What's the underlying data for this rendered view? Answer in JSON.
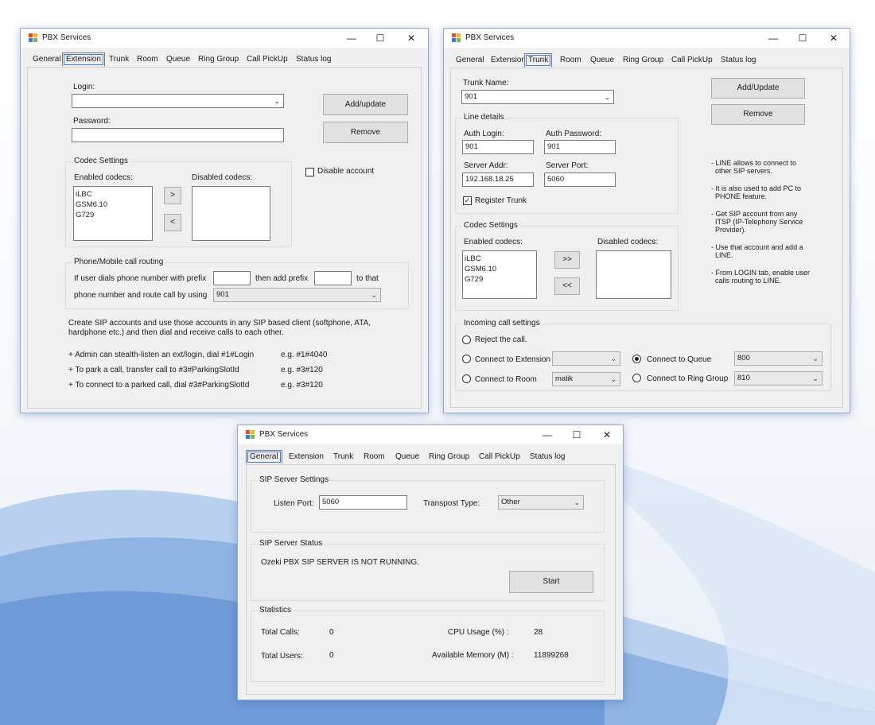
{
  "colors": {
    "window_border": "#8faad6",
    "button_face": "#e1e1e1",
    "form_bg": "#f0f0f0",
    "accent": "#3c7ed6"
  },
  "icons": {
    "app": "pbx-app-icon",
    "minimize": "minimize-icon",
    "maximize": "maximize-icon",
    "close": "close-icon",
    "dropdown": "chevron-down-icon"
  },
  "window_title": "PBX Services",
  "tabs": [
    "General",
    "Extension",
    "Trunk",
    "Room",
    "Queue",
    "Ring Group",
    "Call PickUp",
    "Status log"
  ],
  "ctl": {
    "min": "—",
    "max": "☐",
    "close": "✕",
    "arrow": "⌄",
    "check": "✓"
  },
  "extension": {
    "login_label": "Login:",
    "login_value": "",
    "password_label": "Password:",
    "password_value": "",
    "add_update": "Add/update",
    "remove": "Remove",
    "codec_group": "Codec Settings",
    "enabled_label": "Enabled codecs:",
    "disabled_label": "Disabled codecs:",
    "enabled": [
      "iLBC",
      "GSM6.10",
      "G729"
    ],
    "move_right": ">",
    "move_left": "<",
    "disable_account": "Disable account",
    "routing_group": "Phone/Mobile call routing",
    "prefix_text": "If user dials phone number with prefix",
    "prefix_value": "",
    "add_prefix_text": "then add prefix",
    "add_prefix_value": "",
    "to_that": "to that",
    "route_text": "phone number and route call by using",
    "route_value": "901",
    "info1": "Create SIP accounts and use those accounts in any SIP based client (softphone, ATA,",
    "info2": "hardphone etc.) and then dial and receive calls to each other.",
    "tips": [
      {
        "text": "+ Admin can stealth-listen an ext/login, dial #1#Login",
        "eg": "e.g.  #1#4040"
      },
      {
        "text": "+ To park a call, transfer call to #3#ParkingSlotId",
        "eg": "e.g.  #3#120"
      },
      {
        "text": "+ To connect to a parked call, dial #3#ParkingSlotId",
        "eg": "e.g.  #3#120"
      }
    ]
  },
  "trunk": {
    "trunk_name_label": "Trunk Name:",
    "trunk_name": "901",
    "add_update": "Add/Update",
    "remove": "Remove",
    "line_group": "Line details",
    "auth_login_label": "Auth Login:",
    "auth_login": "901",
    "auth_password_label": "Auth Password:",
    "auth_password": "901",
    "server_addr_label": "Server Addr:",
    "server_addr": "192.168.18.25",
    "server_port_label": "Server Port:",
    "server_port": "5060",
    "register_trunk": "Register Trunk",
    "codec_group": "Codec Settings",
    "enabled_label": "Enabled codecs:",
    "disabled_label": "Disabled codecs:",
    "enabled": [
      "iLBC",
      "GSM6.10",
      "G729"
    ],
    "move_right": ">>",
    "move_left": "<<",
    "notes": [
      "- LINE allows to connect to\n  other SIP servers.",
      "- It is also used to add PC to\n  PHONE feature.",
      "- Get SIP account from any\n  ITSP (IP-Telephony Service\n  Provider).",
      "- Use that account and add a\n  LINE.",
      "- From LOGIN tab, enable user\n  calls routing to LINE."
    ],
    "incoming_group": "Incoming call settings",
    "reject": "Reject the call.",
    "to_extension": "Connect to Extension",
    "extension_value": "",
    "to_queue": "Connect to Queue",
    "queue_value": "800",
    "to_room": "Connect to Room",
    "room_value": "malik",
    "to_ring_group": "Connect to Ring Group",
    "ring_group_value": "810"
  },
  "general": {
    "sip_group": "SIP Server Settings",
    "listen_port_label": "Listen Port:",
    "listen_port": "5060",
    "transport_label": "Transpost Type:",
    "transport_value": "Other",
    "status_group": "SIP Server Status",
    "status_text": "Ozeki PBX SIP SERVER IS NOT RUNNING.",
    "start": "Start",
    "stats_group": "Statistics",
    "total_calls_label": "Total Calls:",
    "total_calls": "0",
    "total_users_label": "Total Users:",
    "total_users": "0",
    "cpu_label": "CPU Usage (%) :",
    "cpu": "28",
    "memory_label": "Available Memory (M) :",
    "memory": "11899268"
  }
}
